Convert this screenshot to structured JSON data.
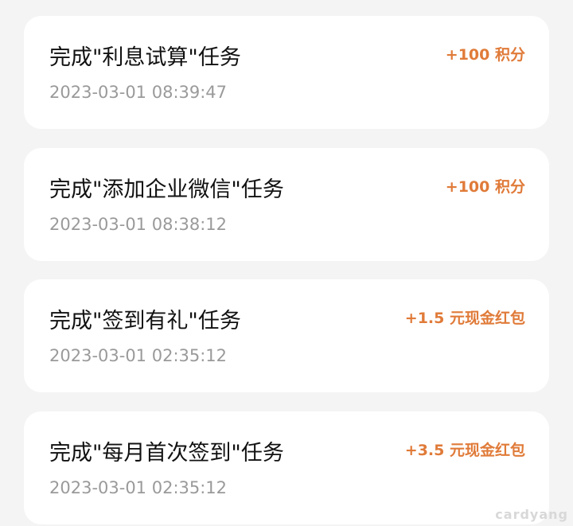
{
  "items": [
    {
      "title": "完成\"利息试算\"任务",
      "time": "2023-03-01 08:39:47",
      "reward": "+100 积分"
    },
    {
      "title": "完成\"添加企业微信\"任务",
      "time": "2023-03-01 08:38:12",
      "reward": "+100 积分"
    },
    {
      "title": "完成\"签到有礼\"任务",
      "time": "2023-03-01 02:35:12",
      "reward": "+1.5 元现金红包"
    },
    {
      "title": "完成\"每月首次签到\"任务",
      "time": "2023-03-01 02:35:12",
      "reward": "+3.5 元现金红包"
    }
  ],
  "watermark": "cardyang",
  "colors": {
    "background": "#f4f4f4",
    "card": "#ffffff",
    "title": "#111111",
    "time": "#9a9a9a",
    "reward": "#e07b39"
  }
}
